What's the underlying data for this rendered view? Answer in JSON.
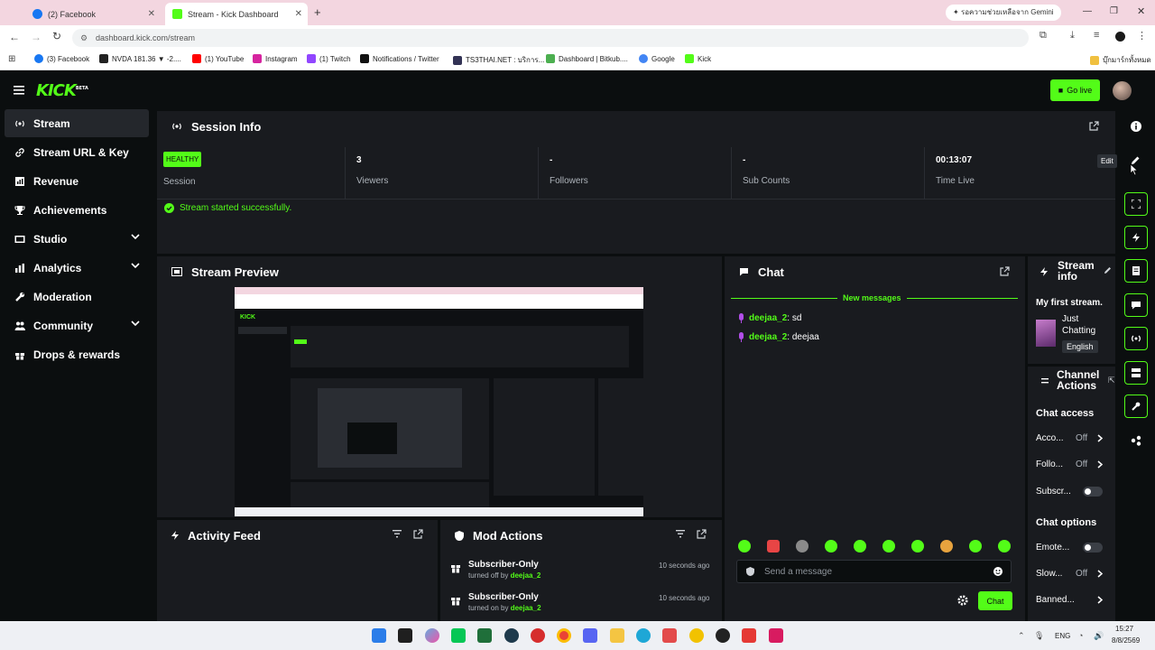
{
  "browser": {
    "tabs": [
      {
        "label": "(2) Facebook"
      },
      {
        "label": "Stream - Kick Dashboard"
      }
    ],
    "gemini_prompt": "รอความช่วยเหลือจาก Gemini",
    "url": "dashboard.kick.com/stream",
    "bookmarks": [
      "(3) Facebook",
      "NVDA 181.36 ▼ -2....",
      "(1) YouTube",
      "Instagram",
      "(1) Twitch",
      "Notifications / Twitter",
      "TS3THAI.NET : บริการ...",
      "Dashboard | Bitkub....",
      "Google",
      "Kick"
    ],
    "all_bookmarks": "บุ๊กมาร์กทั้งหมด"
  },
  "header": {
    "logo": "KICK",
    "logo_tag": "BETA",
    "go_live_label": "Go live"
  },
  "sidebar": {
    "items": [
      {
        "label": "Stream",
        "icon": "broadcast-icon",
        "active": true
      },
      {
        "label": "Stream URL & Key",
        "icon": "link-icon"
      },
      {
        "label": "Revenue",
        "icon": "chart-icon"
      },
      {
        "label": "Achievements",
        "icon": "trophy-icon"
      },
      {
        "label": "Studio",
        "icon": "tv-icon",
        "expandable": true
      },
      {
        "label": "Analytics",
        "icon": "analytics-icon",
        "expandable": true
      },
      {
        "label": "Moderation",
        "icon": "wrench-icon"
      },
      {
        "label": "Community",
        "icon": "people-icon",
        "expandable": true
      },
      {
        "label": "Drops & rewards",
        "icon": "gift-icon"
      }
    ]
  },
  "session_info": {
    "title": "Session Info",
    "stats": [
      {
        "value": "HEALTHY",
        "label": "Session"
      },
      {
        "value": "3",
        "label": "Viewers"
      },
      {
        "value": "-",
        "label": "Followers"
      },
      {
        "value": "-",
        "label": "Sub Counts"
      },
      {
        "value": "00:13:07",
        "label": "Time Live"
      }
    ],
    "status_message": "Stream started successfully.",
    "edit_tooltip": "Edit"
  },
  "stream_preview": {
    "title": "Stream Preview"
  },
  "chat": {
    "title": "Chat",
    "new_messages": "New messages",
    "messages": [
      {
        "user": "deejaa_2",
        "text": "sd"
      },
      {
        "user": "deejaa_2",
        "text": "deejaa"
      }
    ],
    "input_placeholder": "Send a message",
    "send_label": "Chat"
  },
  "stream_info": {
    "title": "Stream info",
    "stream_title": "My first stream.",
    "category_line1": "Just",
    "category_line2": "Chatting",
    "language": "English"
  },
  "channel_actions": {
    "title_line1": "Channel",
    "title_line2": "Actions",
    "chat_access": "Chat access",
    "access_rows": [
      {
        "label": "Acco...",
        "value": "Off"
      },
      {
        "label": "Follo...",
        "value": "Off"
      }
    ],
    "subscribers_label": "Subscr...",
    "chat_options": "Chat options",
    "emotes_label": "Emote...",
    "slow_label": "Slow...",
    "slow_value": "Off",
    "banned_label": "Banned..."
  },
  "activity_feed": {
    "title": "Activity Feed"
  },
  "mod_actions": {
    "title": "Mod Actions",
    "items": [
      {
        "title": "Subscriber-Only",
        "action": "turned off by",
        "user": "deejaa_2",
        "time": "10 seconds ago"
      },
      {
        "title": "Subscriber-Only",
        "action": "turned on by",
        "user": "deejaa_2",
        "time": "10 seconds ago"
      }
    ]
  },
  "taskbar": {
    "lang": "ENG",
    "time": "15:27",
    "date": "8/8/2569"
  },
  "colors": {
    "accent": "#53fc18",
    "panel": "#191b1f",
    "background": "#0b0e0f"
  }
}
